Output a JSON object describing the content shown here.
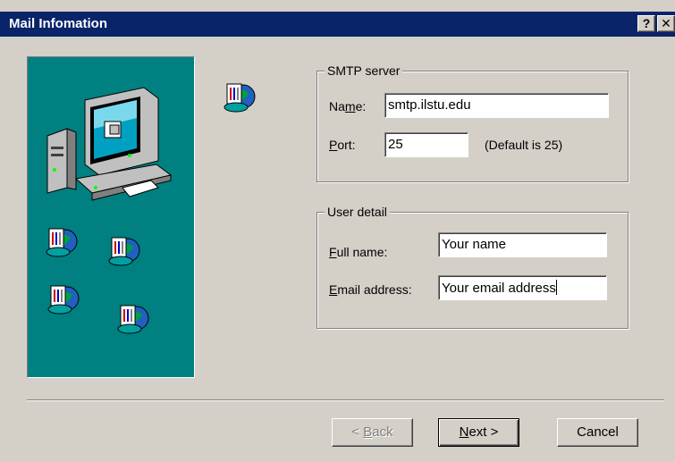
{
  "window": {
    "title": "Mail Infomation",
    "help_glyph": "?",
    "close_glyph": "✕"
  },
  "smtp": {
    "legend": "SMTP server",
    "name_label_prefix": "Na",
    "name_label_mnemonic": "m",
    "name_label_suffix": "e:",
    "name_value": "smtp.ilstu.edu",
    "port_label_mnemonic": "P",
    "port_label_suffix": "ort:",
    "port_value": "25",
    "port_hint": "(Default is 25)"
  },
  "user": {
    "legend": "User detail",
    "fullname_label_mnemonic": "F",
    "fullname_label_suffix": "ull name:",
    "fullname_value": "Your name",
    "email_label_mnemonic": "E",
    "email_label_suffix": "mail address:",
    "email_value": "Your email address"
  },
  "buttons": {
    "back_prefix": "< ",
    "back_mnemonic": "B",
    "back_suffix": "ack",
    "next_mnemonic": "N",
    "next_suffix": "ext >",
    "cancel": "Cancel"
  },
  "colors": {
    "titlebar": "#0a246a",
    "panel": "#008080",
    "dialog": "#d4d0c8"
  },
  "icons": [
    "computer-icon",
    "mail-globe-icon",
    "help-icon",
    "close-icon"
  ]
}
